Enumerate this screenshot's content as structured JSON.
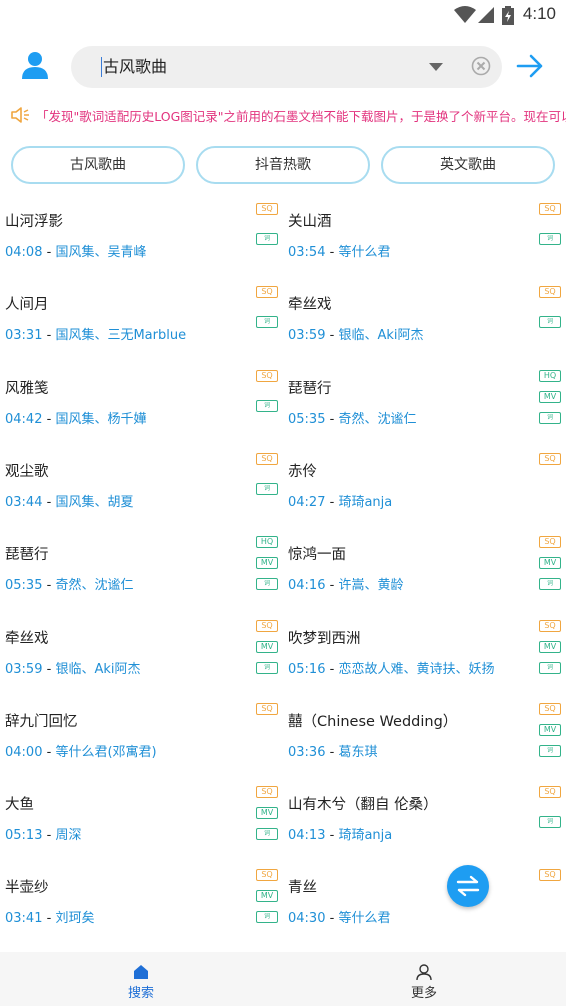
{
  "status_bar": {
    "time": "4:10"
  },
  "search": {
    "query": "古风歌曲"
  },
  "marquee": {
    "text": "「发现\"歌词适配历史LOG图记录\"之前用的石墨文档不能下载图片，于是换了个新平台。现在可以下载了"
  },
  "chips": [
    {
      "label": "古风歌曲"
    },
    {
      "label": "抖音热歌"
    },
    {
      "label": "英文歌曲"
    }
  ],
  "songs": [
    {
      "title": "山河浮影",
      "duration": "04:08",
      "artist": "国风集、吴青峰",
      "badges": [
        "SQ",
        "词"
      ]
    },
    {
      "title": "关山酒",
      "duration": "03:54",
      "artist": "等什么君",
      "badges": [
        "SQ",
        "词"
      ]
    },
    {
      "title": "人间月",
      "duration": "03:31",
      "artist": "国风集、三无Marblue",
      "badges": [
        "SQ",
        "词"
      ]
    },
    {
      "title": "牵丝戏",
      "duration": "03:59",
      "artist": "银临、Aki阿杰",
      "badges": [
        "SQ",
        "词"
      ]
    },
    {
      "title": "风雅笺",
      "duration": "04:42",
      "artist": "国风集、杨千嬅",
      "badges": [
        "SQ",
        "词"
      ]
    },
    {
      "title": "琵琶行",
      "duration": "05:35",
      "artist": "奇然、沈谧仁",
      "badges": [
        "HQ",
        "MV",
        "词"
      ]
    },
    {
      "title": "观尘歌",
      "duration": "03:44",
      "artist": "国风集、胡夏",
      "badges": [
        "SQ",
        "词"
      ]
    },
    {
      "title": "赤伶",
      "duration": "04:27",
      "artist": "琦琦anja",
      "badges": [
        "SQ"
      ]
    },
    {
      "title": "琵琶行",
      "duration": "05:35",
      "artist": "奇然、沈谧仁",
      "badges": [
        "HQ",
        "MV",
        "词"
      ]
    },
    {
      "title": "惊鸿一面",
      "duration": "04:16",
      "artist": "许嵩、黄龄",
      "badges": [
        "SQ",
        "MV",
        "词"
      ]
    },
    {
      "title": "牵丝戏",
      "duration": "03:59",
      "artist": "银临、Aki阿杰",
      "badges": [
        "SQ",
        "MV",
        "词"
      ]
    },
    {
      "title": "吹梦到西洲",
      "duration": "05:16",
      "artist": "恋恋故人难、黄诗扶、妖扬",
      "badges": [
        "SQ",
        "MV",
        "词"
      ]
    },
    {
      "title": "辞九门回忆",
      "duration": "04:00",
      "artist": "等什么君(邓寓君)",
      "badges": [
        "SQ"
      ]
    },
    {
      "title": "囍（Chinese Wedding）",
      "duration": "03:36",
      "artist": "葛东琪",
      "badges": [
        "SQ",
        "MV",
        "词"
      ]
    },
    {
      "title": "大鱼",
      "duration": "05:13",
      "artist": "周深",
      "badges": [
        "SQ",
        "MV",
        "词"
      ]
    },
    {
      "title": "山有木兮（翻自 伦桑）",
      "duration": "04:13",
      "artist": "琦琦anja",
      "badges": [
        "SQ",
        "词"
      ]
    },
    {
      "title": "半壶纱",
      "duration": "03:41",
      "artist": "刘珂矣",
      "badges": [
        "SQ",
        "MV",
        "词"
      ]
    },
    {
      "title": "青丝",
      "duration": "04:30",
      "artist": "等什么君",
      "badges": [
        "SQ"
      ]
    }
  ],
  "bottom_nav": [
    {
      "label": "搜索",
      "icon": "home-icon",
      "active": true
    },
    {
      "label": "更多",
      "icon": "person-icon",
      "active": false
    }
  ],
  "colors": {
    "accent": "#1e9df2",
    "marquee": "#e2337e",
    "link": "#1f8fd6",
    "sq": "#f0a640",
    "hq": "#33b38a"
  }
}
